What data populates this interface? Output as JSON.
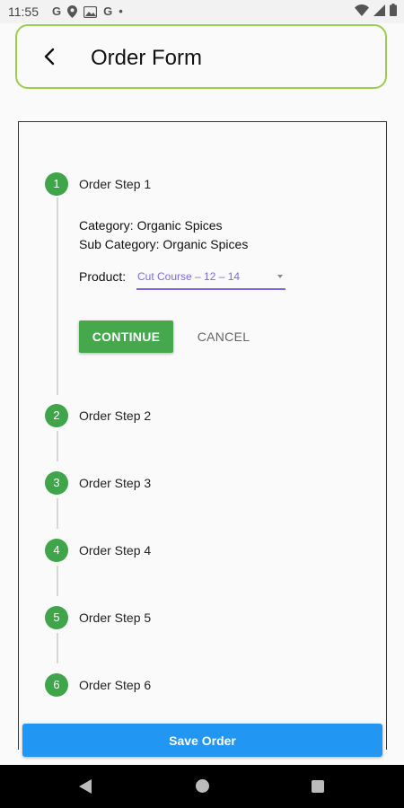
{
  "status_bar": {
    "time": "11:55",
    "left_icons": [
      "G",
      "location-icon",
      "gallery-icon",
      "G",
      "•"
    ],
    "right_icons": [
      "wifi-icon",
      "signal-icon",
      "battery-icon"
    ]
  },
  "header": {
    "title": "Order Form",
    "back_icon": "arrow-back-icon"
  },
  "stepper": {
    "steps": [
      {
        "number": "1",
        "title": "Order Step 1"
      },
      {
        "number": "2",
        "title": "Order Step 2"
      },
      {
        "number": "3",
        "title": "Order Step 3"
      },
      {
        "number": "4",
        "title": "Order Step 4"
      },
      {
        "number": "5",
        "title": "Order Step 5"
      },
      {
        "number": "6",
        "title": "Order Step 6"
      }
    ],
    "active": {
      "category": "Category: Organic Spices",
      "sub_category": "Sub Category: Organic Spices",
      "product_label": "Product:",
      "product_value": "Cut Course – 12 – 14",
      "continue_label": "CONTINUE",
      "cancel_label": "CANCEL"
    }
  },
  "save_button": "Save Order",
  "colors": {
    "accent_green": "#3fa44a",
    "header_border": "#9ccc50",
    "dropdown_purple": "#7e6ae0",
    "save_blue": "#2196f3"
  },
  "nav_bar": [
    "back-icon",
    "home-icon",
    "recents-icon"
  ]
}
